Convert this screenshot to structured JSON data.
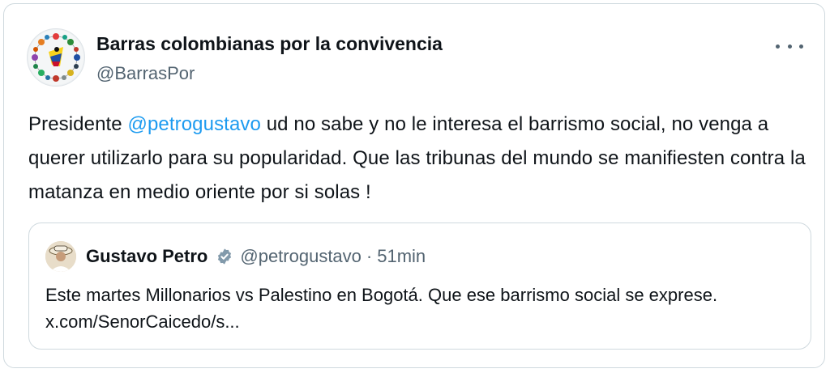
{
  "tweet": {
    "author_name": "Barras colombianas por la convivencia",
    "author_handle": "@BarrasPor",
    "more_label": "More",
    "text_before_mention": "Presidente ",
    "mention": "@petrogustavo",
    "text_after_mention": " ud no sabe y no le interesa el barrismo social, no venga a querer utilizarlo para su popularidad. Que las tribunas del mundo se manifiesten contra la matanza en medio oriente por si solas !"
  },
  "quoted_tweet": {
    "author_name": "Gustavo Petro",
    "author_handle": "@petrogustavo",
    "separator": "·",
    "time": "51min",
    "text": "Este martes Millonarios vs Palestino en Bogotá. Que ese barrismo social se exprese. x.com/SenorCaicedo/s..."
  },
  "colors": {
    "link": "#1d9bf0",
    "secondary_text": "#536471",
    "verified_badge": "#829aab",
    "border": "#cfd9de"
  },
  "icons": {
    "more": "more-horizontal-icon",
    "verified": "verified-badge-icon"
  }
}
